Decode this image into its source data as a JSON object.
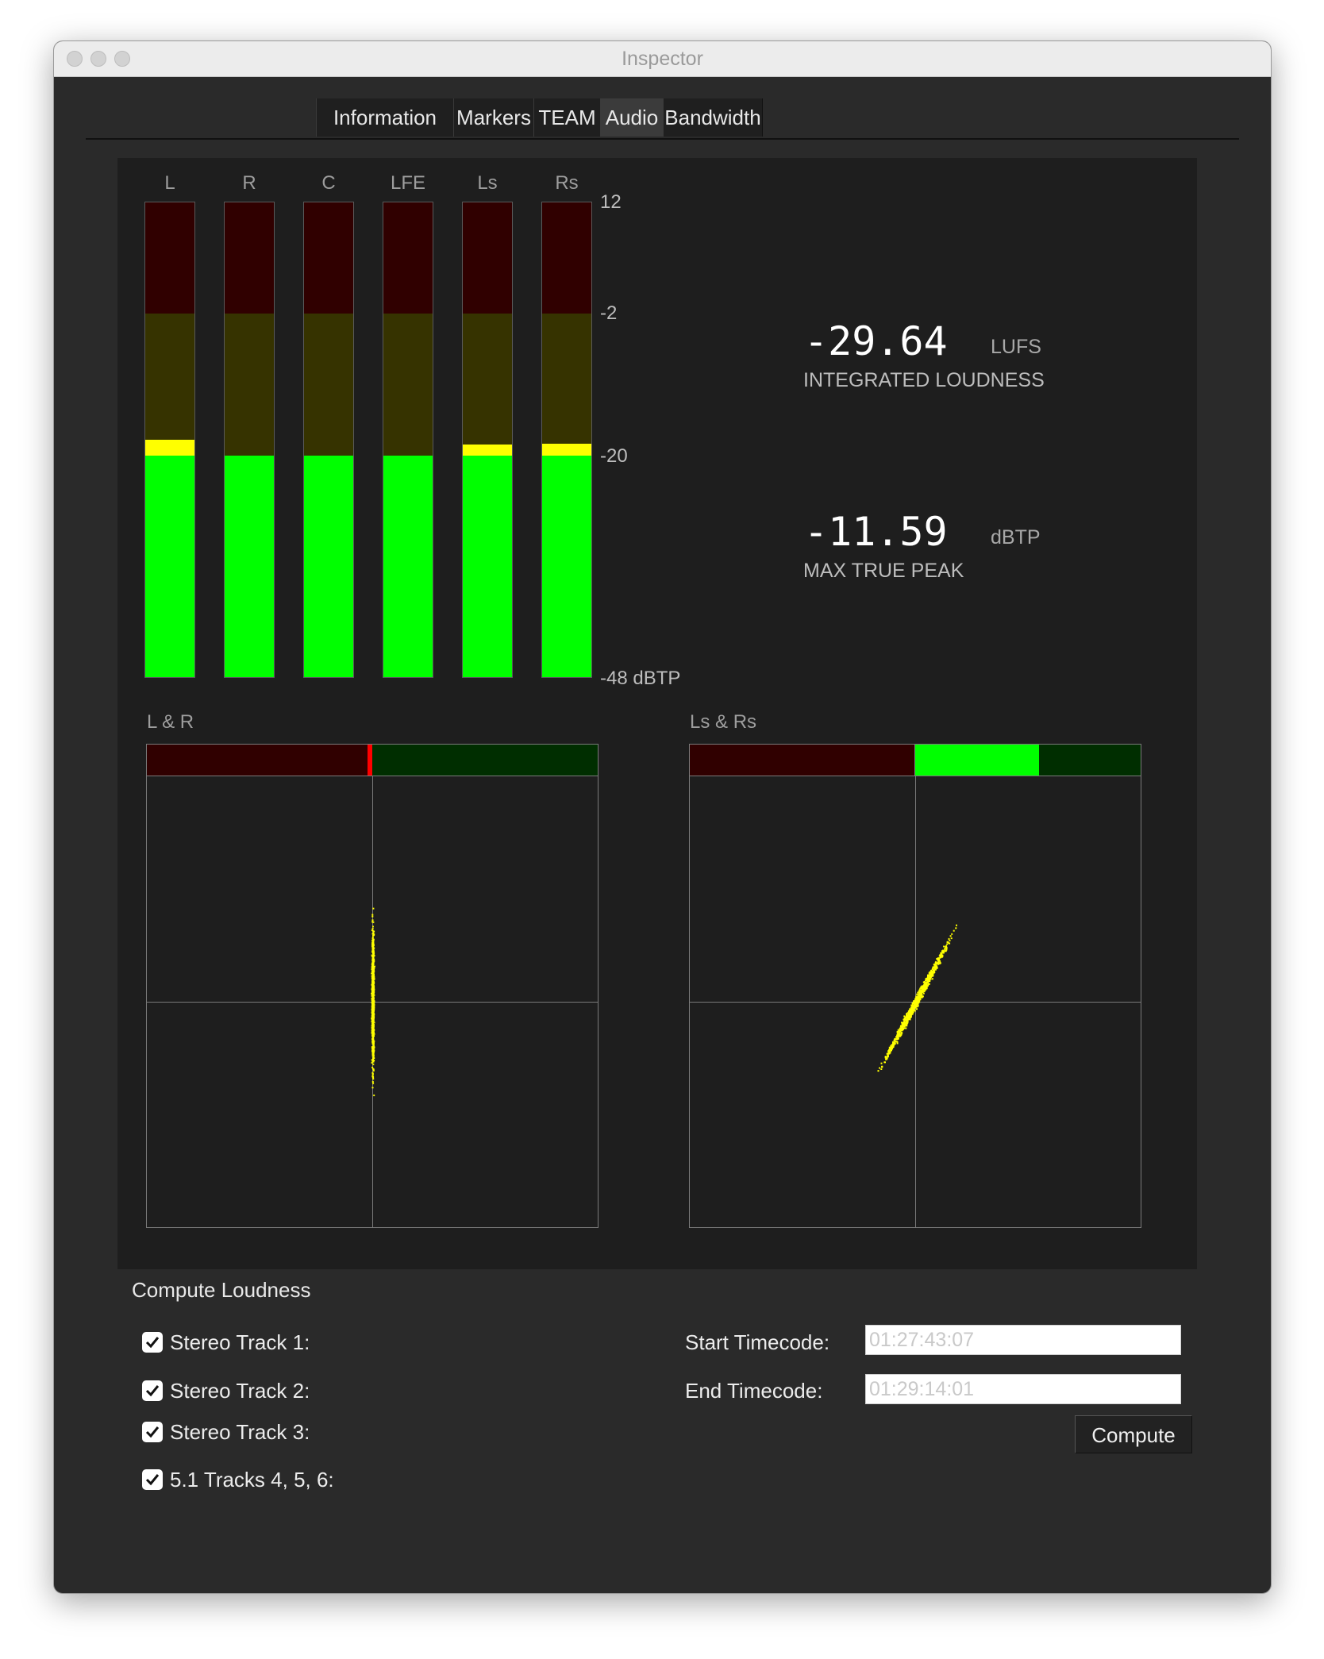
{
  "window": {
    "title": "Inspector"
  },
  "tabs": [
    {
      "label": "Information",
      "active": false
    },
    {
      "label": "Markers",
      "active": false
    },
    {
      "label": "TEAM",
      "active": false
    },
    {
      "label": "Audio",
      "active": true
    },
    {
      "label": "Bandwidth",
      "active": false
    }
  ],
  "meters": {
    "channels": [
      {
        "label": "L",
        "level_db": -18
      },
      {
        "label": "R",
        "level_db": -20
      },
      {
        "label": "C",
        "level_db": -20
      },
      {
        "label": "LFE",
        "level_db": -20
      },
      {
        "label": "Ls",
        "level_db": -18.6
      },
      {
        "label": "Rs",
        "level_db": -18.5
      }
    ],
    "scale_labels": [
      "12",
      "-2",
      "-20",
      "-48 dBTP"
    ],
    "zone_thresholds_db": {
      "red_above": -2,
      "yellow_above": -20,
      "min": -48,
      "max": 12
    },
    "colors": {
      "green_on": "#00ff00",
      "green_off": "#002e00",
      "yellow_on": "#ffff00",
      "yellow_off": "#363300",
      "red_on": "#ff0000",
      "red_off": "#300000"
    }
  },
  "loudness": {
    "integrated_value": "-29.64",
    "integrated_unit": "LUFS",
    "integrated_caption": "INTEGRATED LOUDNESS",
    "peak_value": "-11.59",
    "peak_unit": "dBTP",
    "peak_caption": "MAX TRUE PEAK"
  },
  "vectorscopes": [
    {
      "label": "L & R",
      "correlation": -0.02,
      "trace_color": "#ffff00"
    },
    {
      "label": "Ls & Rs",
      "correlation": 0.55,
      "trace_color": "#ffff00"
    }
  ],
  "compute": {
    "title": "Compute Loudness",
    "tracks": [
      {
        "label": "Stereo Track 1:",
        "checked": true
      },
      {
        "label": "Stereo Track 2:",
        "checked": true
      },
      {
        "label": "Stereo Track 3:",
        "checked": true
      },
      {
        "label": "5.1 Tracks 4, 5, 6:",
        "checked": true
      }
    ],
    "start_label": "Start Timecode:",
    "start_value": "01:27:43:07",
    "end_label": "End Timecode:",
    "end_value": "01:29:14:01",
    "button_label": "Compute"
  }
}
